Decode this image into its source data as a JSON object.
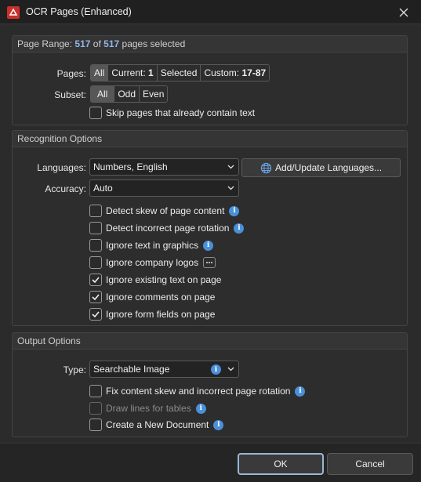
{
  "window": {
    "title": "OCR Pages (Enhanced)",
    "icons": {
      "app": "pdf-app-icon",
      "close": "close-icon"
    }
  },
  "page_range": {
    "header_prefix": "Page Range:",
    "selected_count": "517",
    "of_word": "of",
    "total_count": "517",
    "header_suffix": "pages selected",
    "pages_label": "Pages:",
    "pages_options": {
      "all": "All",
      "current_label": "Current:",
      "current_value": "1",
      "selected": "Selected",
      "custom_label": "Custom:",
      "custom_value": "17-87"
    },
    "subset_label": "Subset:",
    "subset_options": [
      "All",
      "Odd",
      "Even"
    ],
    "skip_label": "Skip pages that already contain text",
    "skip_checked": false
  },
  "recognition": {
    "header": "Recognition Options",
    "languages_label": "Languages:",
    "languages_value": "Numbers, English",
    "add_languages_button": "Add/Update Languages...",
    "accuracy_label": "Accuracy:",
    "accuracy_value": "Auto",
    "options": [
      {
        "label": "Detect skew of page content",
        "checked": false,
        "icon": "info-icon"
      },
      {
        "label": "Detect incorrect page rotation",
        "checked": false,
        "icon": "info-icon"
      },
      {
        "label": "Ignore text in graphics",
        "checked": false,
        "icon": "info-icon"
      },
      {
        "label": "Ignore company logos",
        "checked": false,
        "icon": "more-icon"
      },
      {
        "label": "Ignore existing text on page",
        "checked": true
      },
      {
        "label": "Ignore comments on page",
        "checked": true
      },
      {
        "label": "Ignore form fields on page",
        "checked": true
      }
    ]
  },
  "output": {
    "header": "Output Options",
    "type_label": "Type:",
    "type_value": "Searchable Image",
    "options": [
      {
        "label": "Fix content skew and incorrect page rotation",
        "checked": false,
        "disabled": false
      },
      {
        "label": "Draw lines for tables",
        "checked": false,
        "disabled": true
      },
      {
        "label": "Create a New Document",
        "checked": false,
        "disabled": false
      }
    ]
  },
  "footer": {
    "ok_label": "OK",
    "cancel_label": "Cancel"
  },
  "colors": {
    "background": "#2b2b2b",
    "accent": "#4a90d9",
    "highlight": "#8fb6e8"
  }
}
